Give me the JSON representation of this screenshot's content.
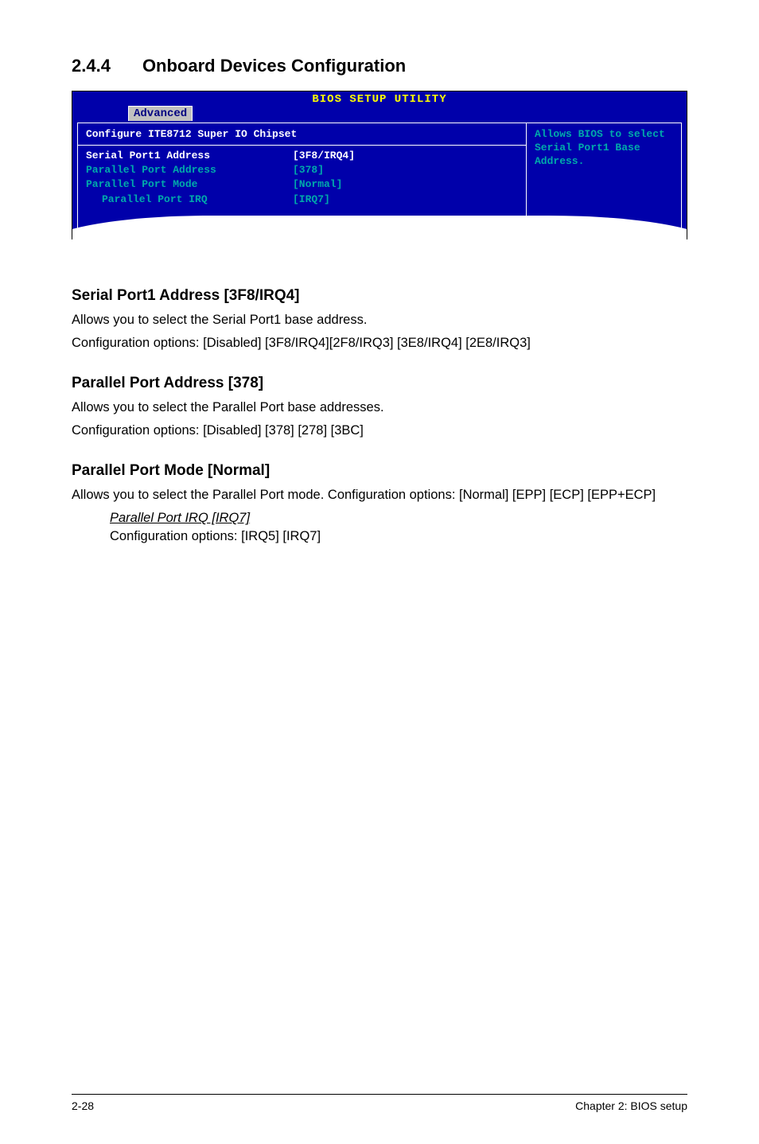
{
  "section": {
    "number": "2.4.4",
    "title": "Onboard Devices Configuration"
  },
  "bios": {
    "utility_title": "BIOS SETUP UTILITY",
    "tab": "Advanced",
    "panel_title": "Configure ITE8712 Super IO Chipset",
    "rows": [
      {
        "label": "Serial Port1 Address",
        "value": "[3F8/IRQ4]",
        "highlight": true,
        "indent": false
      },
      {
        "label": "Parallel Port Address",
        "value": "[378]",
        "highlight": false,
        "indent": false
      },
      {
        "label": "Parallel Port Mode",
        "value": "[Normal]",
        "highlight": false,
        "indent": false
      },
      {
        "label": "Parallel Port IRQ",
        "value": "[IRQ7]",
        "highlight": false,
        "indent": true
      }
    ],
    "help_text": "Allows BIOS to select Serial Port1 Base Address."
  },
  "subsections": [
    {
      "title": "Serial Port1 Address [3F8/IRQ4]",
      "lines": [
        "Allows you to select the Serial Port1 base address.",
        "Configuration options: [Disabled] [3F8/IRQ4][2F8/IRQ3] [3E8/IRQ4] [2E8/IRQ3]"
      ]
    },
    {
      "title": "Parallel Port Address [378]",
      "lines": [
        "Allows you to select the Parallel Port base addresses.",
        "Configuration options: [Disabled] [378] [278] [3BC]"
      ]
    },
    {
      "title": "Parallel Port Mode [Normal]",
      "lines": [
        "Allows you to select the Parallel Port  mode. Configuration options: [Normal] [EPP] [ECP] [EPP+ECP]"
      ],
      "subitem": {
        "title": "Parallel Port IRQ [IRQ7]",
        "line": "Configuration options: [IRQ5] [IRQ7]"
      }
    }
  ],
  "footer": {
    "left": "2-28",
    "right": "Chapter 2: BIOS setup"
  }
}
